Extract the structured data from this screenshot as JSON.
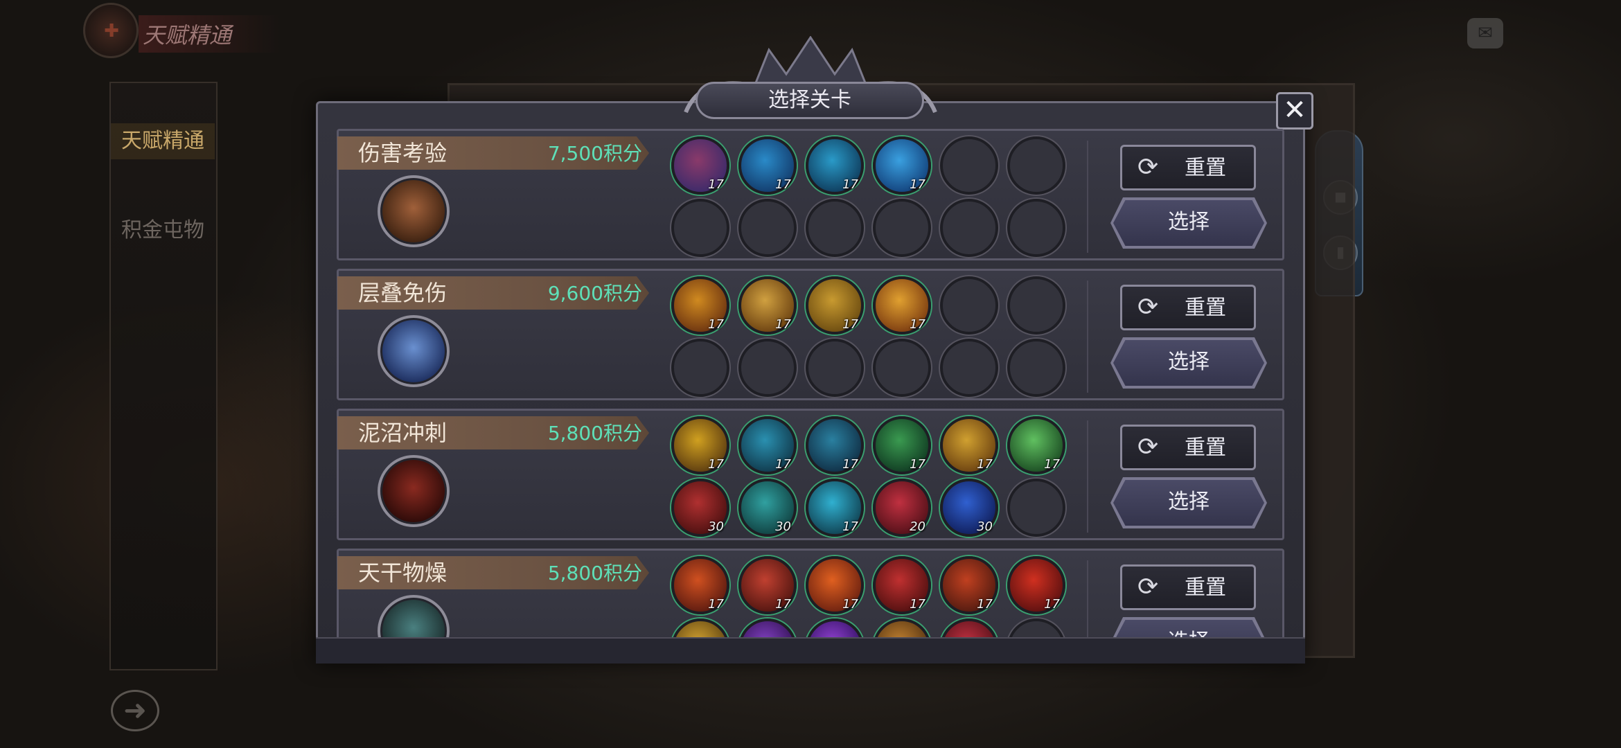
{
  "header": {
    "title": "天赋精通"
  },
  "sidebar": {
    "items": [
      {
        "label": "天赋精通",
        "active": true
      },
      {
        "label": "积金屯物",
        "active": false
      }
    ]
  },
  "dialog": {
    "title": "选择关卡",
    "close_label": "✕",
    "rows": [
      {
        "name": "伤害考验",
        "score": "7,500积分",
        "boss": "boar-boss",
        "skills_top": [
          "17",
          "17",
          "17",
          "17",
          null,
          null
        ],
        "skills_bottom": [
          null,
          null,
          null,
          null,
          null,
          null
        ],
        "reset_label": "重置",
        "select_label": "选择"
      },
      {
        "name": "层叠免伤",
        "score": "9,600积分",
        "boss": "ice-golem-boss",
        "skills_top": [
          "17",
          "17",
          "17",
          "17",
          null,
          null
        ],
        "skills_bottom": [
          null,
          null,
          null,
          null,
          null,
          null
        ],
        "reset_label": "重置",
        "select_label": "选择"
      },
      {
        "name": "泥沼冲刺",
        "score": "5,800积分",
        "boss": "fire-demon-boss",
        "skills_top": [
          "17",
          "17",
          "17",
          "17",
          "17",
          "17"
        ],
        "skills_bottom": [
          "30",
          "30",
          "17",
          "20",
          "30",
          null
        ],
        "reset_label": "重置",
        "select_label": "选择"
      },
      {
        "name": "天干物燥",
        "score": "5,800积分",
        "boss": "armored-beast-boss",
        "skills_top": [
          "17",
          "17",
          "17",
          "17",
          "17",
          "17"
        ],
        "skills_bottom": [
          "",
          "",
          "",
          "",
          "",
          null
        ],
        "reset_label": "重置",
        "select_label": "选择"
      }
    ]
  },
  "colors": {
    "score": "#5ee0b8",
    "label_bar": "#7a5f4c",
    "panel": "#34343e"
  },
  "icons": {
    "reset": "refresh-icon",
    "close": "close-icon",
    "back": "back-arrow-icon",
    "chat": "chat-icon"
  }
}
